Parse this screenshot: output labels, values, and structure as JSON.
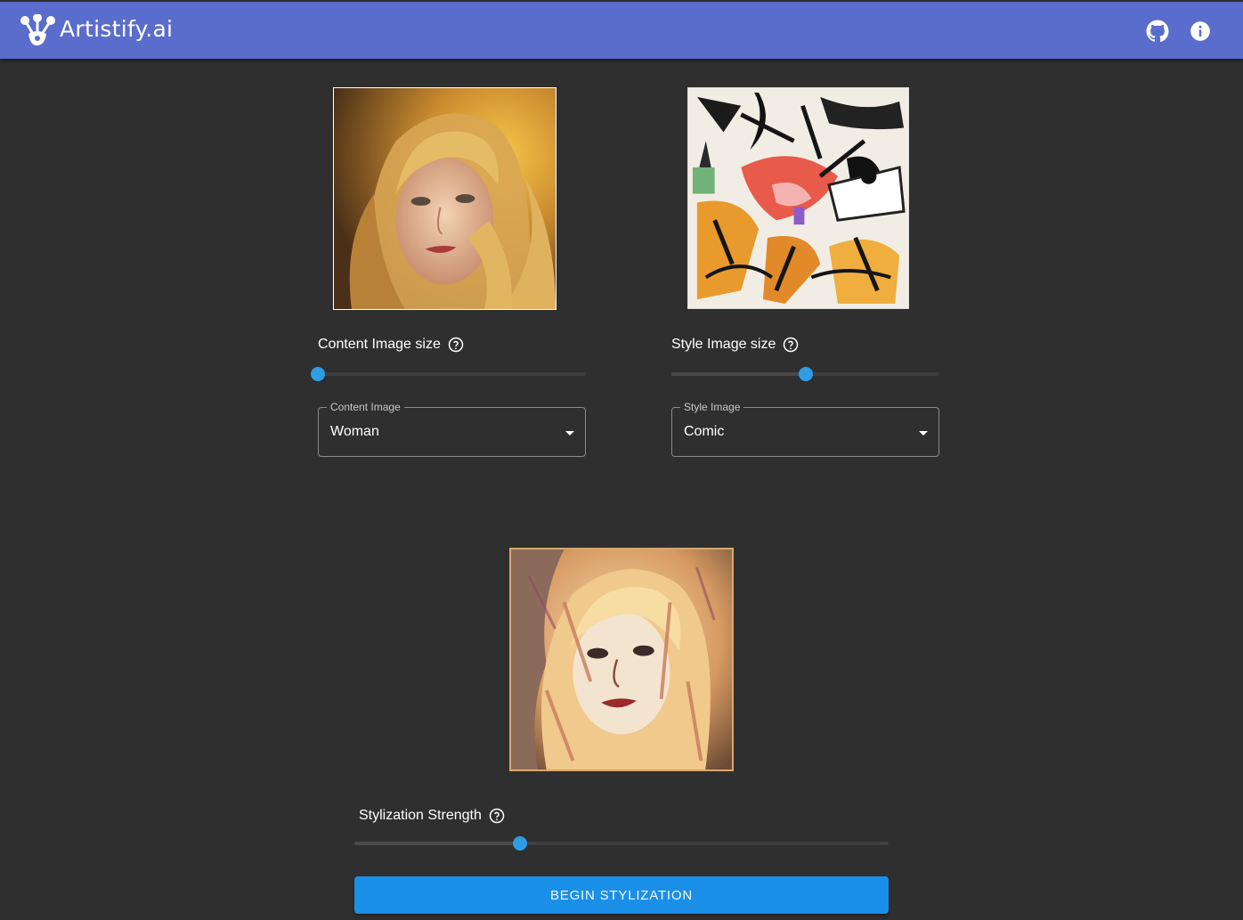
{
  "app": {
    "title": "Artistify.ai",
    "accent_color": "#5a6ccc",
    "icons": {
      "logo": "paw-logo-icon",
      "github": "github-icon",
      "info": "info-icon"
    }
  },
  "content": {
    "image_alt": "Woman",
    "size_label": "Content Image size",
    "size_value": 0.0,
    "select_label": "Content Image",
    "select_value": "Woman"
  },
  "style": {
    "image_alt": "Comic",
    "size_label": "Style Image size",
    "size_value": 0.5,
    "select_label": "Style Image",
    "select_value": "Comic"
  },
  "stylization": {
    "strength_label": "Stylization Strength",
    "strength_value": 0.31,
    "button_label": "BEGIN STYLIZATION",
    "button_color": "#1a8fe8",
    "slider_color": "#2f9de6"
  }
}
